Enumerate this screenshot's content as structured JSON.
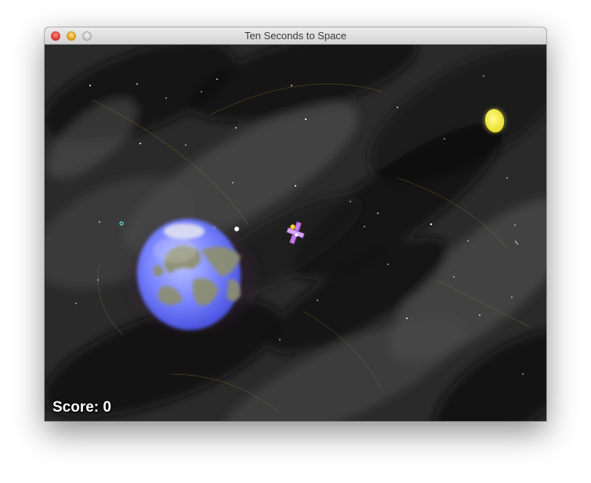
{
  "window": {
    "title": "Ten Seconds to Space",
    "controls": [
      "close",
      "minimize",
      "zoom"
    ]
  },
  "game": {
    "score_label": "Score: 0",
    "score": 0,
    "objects": [
      "earth",
      "satellite",
      "moon",
      "stars",
      "debris"
    ],
    "colors": {
      "space": "#2a2a2a",
      "earth_ocean": "#6f7dff",
      "earth_land": "#8d8f6a",
      "moon": "#f2ec44",
      "satellite": "#c27be3"
    }
  }
}
